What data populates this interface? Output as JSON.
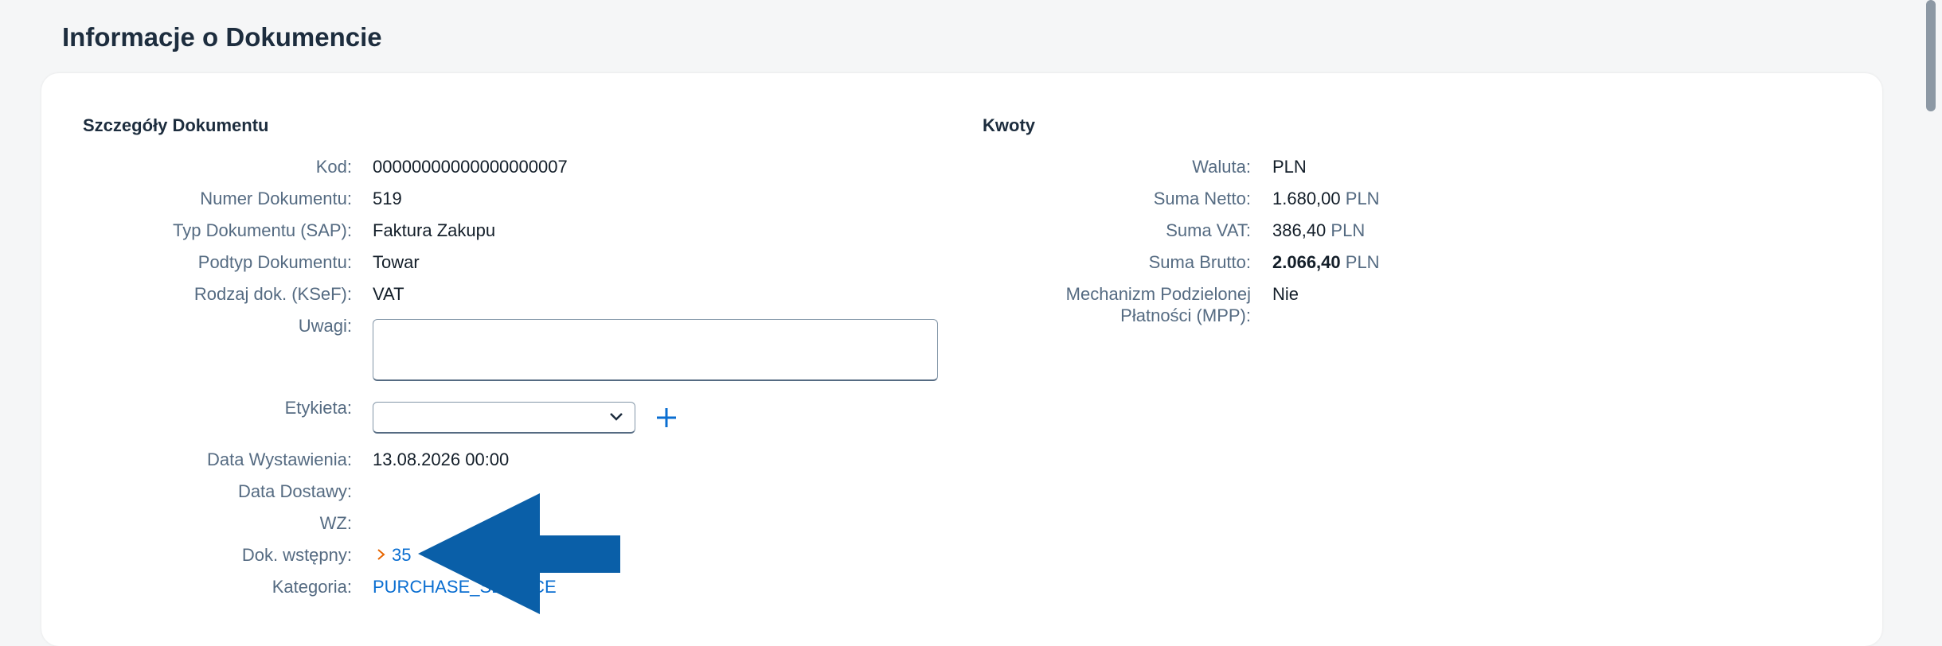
{
  "page_title": "Informacje o Dokumencie",
  "document_details": {
    "title": "Szczegóły Dokumentu",
    "code_label": "Kod:",
    "code_value": "00000000000000000007",
    "number_label": "Numer Dokumentu:",
    "number_value": "519",
    "type_label": "Typ Dokumentu (SAP):",
    "type_value": "Faktura Zakupu",
    "subtype_label": "Podtyp Dokumentu:",
    "subtype_value": "Towar",
    "ksef_label": "Rodzaj dok. (KSeF):",
    "ksef_value": "VAT",
    "notes_label": "Uwagi:",
    "notes_value": "",
    "tag_label": "Etykieta:",
    "tag_value": "",
    "issue_date_label": "Data Wystawienia:",
    "issue_date_value": "13.08.2026 00:00",
    "delivery_date_label": "Data Dostawy:",
    "delivery_date_value": "",
    "wz_label": "WZ:",
    "wz_value": "",
    "preliminary_label": "Dok. wstępny:",
    "preliminary_value": "35",
    "category_label": "Kategoria:",
    "category_value": "PURCHASE_SERVICE"
  },
  "amounts": {
    "title": "Kwoty",
    "currency_label": "Waluta:",
    "currency_value": "PLN",
    "net_label": "Suma Netto:",
    "net_value": "1.680,00",
    "net_unit": "PLN",
    "vat_label": "Suma VAT:",
    "vat_value": "386,40",
    "vat_unit": "PLN",
    "gross_label": "Suma Brutto:",
    "gross_value": "2.066,40",
    "gross_unit": "PLN",
    "mpp_label_line1": "Mechanizm Podzielonej",
    "mpp_label_line2": "Płatności (MPP):",
    "mpp_value": "Nie"
  },
  "icons": {
    "chevron": "chevron-down-icon",
    "add": "add-icon",
    "nav_arrow": "chevron-right-icon",
    "annotation": "arrow-left-icon"
  },
  "colors": {
    "link": "#0a6ed1",
    "arrow_annotation": "#0a5fa8",
    "nav_chevron": "#e76500"
  }
}
